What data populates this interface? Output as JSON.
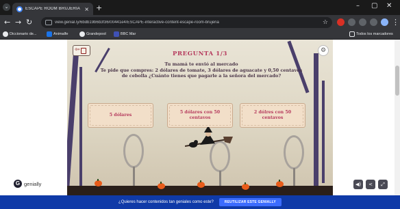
{
  "browser": {
    "tab_title": "ESCAPE ROOM BRUJERIA",
    "tab_close": "×",
    "new_tab": "+",
    "window_controls": [
      "–",
      "▢",
      "✕"
    ],
    "url": "view.genial.ly/6bdb19b6b3f36/00441e4/ESCAPE-interactive-content-escape-room-brujeria",
    "bookmarks": [
      {
        "label": "Diccionario de...",
        "color": "#e8eaed"
      },
      {
        "label": "Animalfe",
        "color": "#1a73e8"
      },
      {
        "label": "Grandepool",
        "color": "#e8eaed"
      },
      {
        "label": "BBC Mar",
        "color": "#3f51b5"
      }
    ],
    "bookmarks_right": "Todos los marcadores"
  },
  "slide": {
    "title": "PREGUNTA 1/3",
    "question_line1": "Tu mamá te envió al mercado",
    "question_line2": "Te pide que compres: 2 dólares de tomate, 3 dólares de aguacate y 0,50 centavos de cebolla ¿Cuánto tienes que pagarle a la señora del mercado?",
    "answers": [
      "5 dólares",
      "5 dólares con 50 centavos",
      "2 dólres con 50 centavos"
    ]
  },
  "genially": {
    "logo_text": "genially",
    "logo_mark": "G",
    "controls": [
      "◀)",
      "<",
      "⤢"
    ]
  },
  "banner": {
    "message": "¿Quieres hacer contenidos tan geniales como este?",
    "cta": "REUTILIZAR ESTE GENIALLY"
  },
  "colors": {
    "title": "#b5395c",
    "banner_bg": "#0f3aa8",
    "cta_bg": "#3b6cff",
    "answer_bg": "#f2dfc9"
  }
}
